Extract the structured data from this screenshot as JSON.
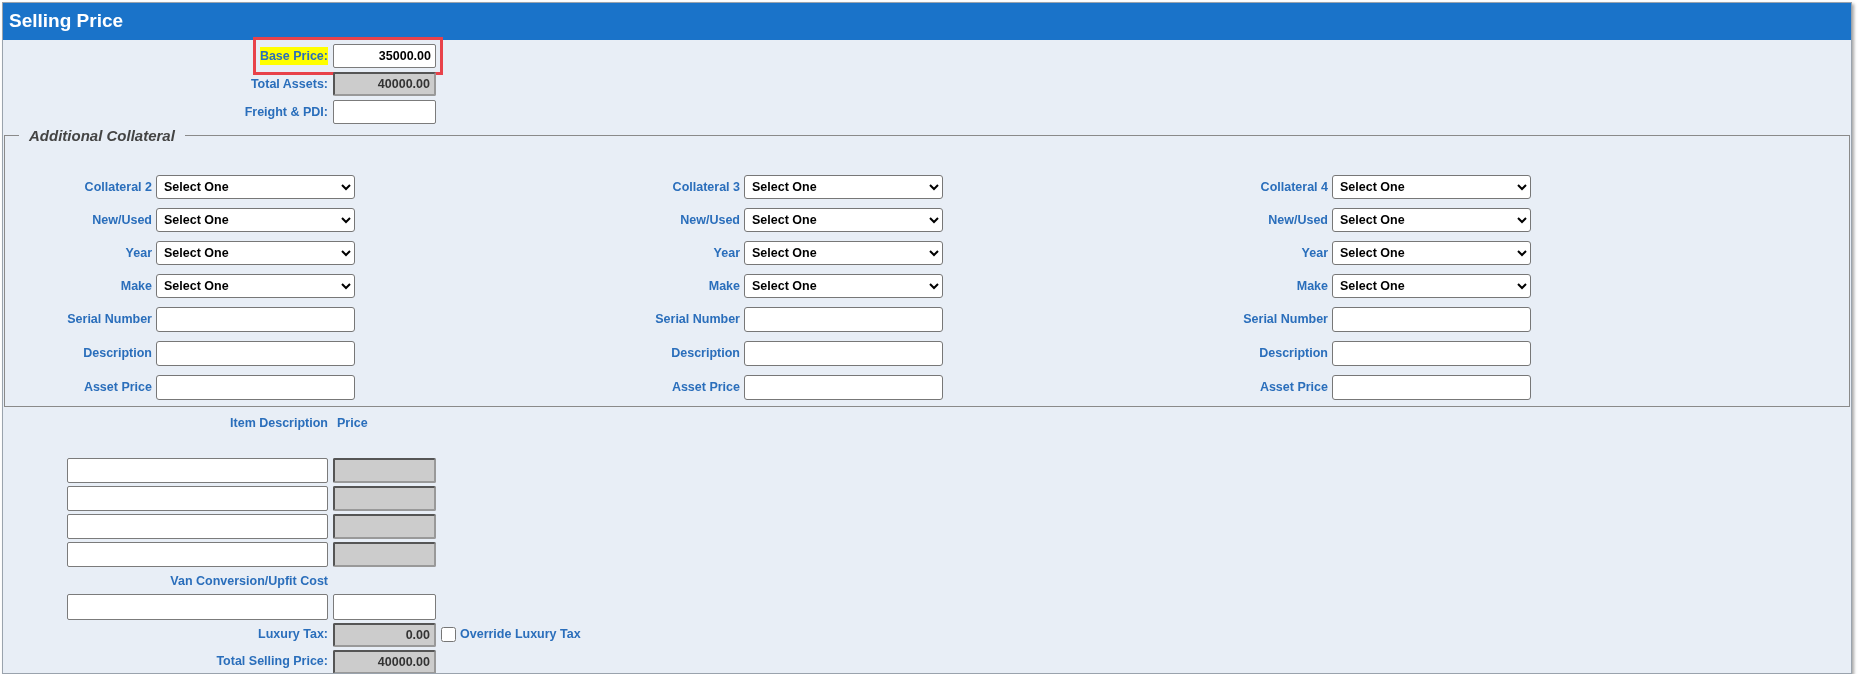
{
  "header": {
    "title": "Selling Price"
  },
  "top_fields": [
    {
      "label": "Base Price:",
      "value": "35000.00",
      "disabled": false,
      "highlighted": true
    },
    {
      "label": "Total Assets:",
      "value": "40000.00",
      "disabled": true,
      "highlighted": false
    },
    {
      "label": "Freight & PDI:",
      "disabled": false,
      "highlighted": false
    }
  ],
  "collateral": {
    "legend": "Additional Collateral",
    "columns": [
      {
        "fields": [
          {
            "label": "Collateral 2",
            "kind": "select",
            "value": "Select One"
          },
          {
            "label": "New/Used",
            "kind": "select",
            "value": "Select One"
          },
          {
            "label": "Year",
            "kind": "select",
            "value": "Select One"
          },
          {
            "label": "Make",
            "kind": "select",
            "value": "Select One"
          },
          {
            "label": "Serial Number",
            "kind": "text"
          },
          {
            "label": "Description",
            "kind": "text"
          },
          {
            "label": "Asset Price",
            "kind": "text"
          }
        ]
      },
      {
        "fields": [
          {
            "label": "Collateral 3",
            "kind": "select",
            "value": "Select One"
          },
          {
            "label": "New/Used",
            "kind": "select",
            "value": "Select One"
          },
          {
            "label": "Year",
            "kind": "select",
            "value": "Select One"
          },
          {
            "label": "Make",
            "kind": "select",
            "value": "Select One"
          },
          {
            "label": "Serial Number",
            "kind": "text"
          },
          {
            "label": "Description",
            "kind": "text"
          },
          {
            "label": "Asset Price",
            "kind": "text"
          }
        ]
      },
      {
        "fields": [
          {
            "label": "Collateral 4",
            "kind": "select",
            "value": "Select One"
          },
          {
            "label": "New/Used",
            "kind": "select",
            "value": "Select One"
          },
          {
            "label": "Year",
            "kind": "select",
            "value": "Select One"
          },
          {
            "label": "Make",
            "kind": "select",
            "value": "Select One"
          },
          {
            "label": "Serial Number",
            "kind": "text"
          },
          {
            "label": "Description",
            "kind": "text"
          },
          {
            "label": "Asset Price",
            "kind": "text"
          }
        ]
      }
    ]
  },
  "items": {
    "columns": [
      "Item Description",
      "Price"
    ],
    "rows": [
      {
        "price_disabled": true
      },
      {
        "price_disabled": true
      },
      {
        "price_disabled": true
      },
      {
        "price_disabled": true
      }
    ]
  },
  "van_conversion": {
    "label": "Van Conversion/Upfit Cost",
    "price_disabled": false
  },
  "luxury_tax": {
    "label": "Luxury Tax:",
    "value": "0.00",
    "disabled": true,
    "override": {
      "label": "Override Luxury Tax",
      "checked": false
    }
  },
  "total": {
    "label": "Total Selling Price:",
    "value": "40000.00",
    "disabled": true
  }
}
